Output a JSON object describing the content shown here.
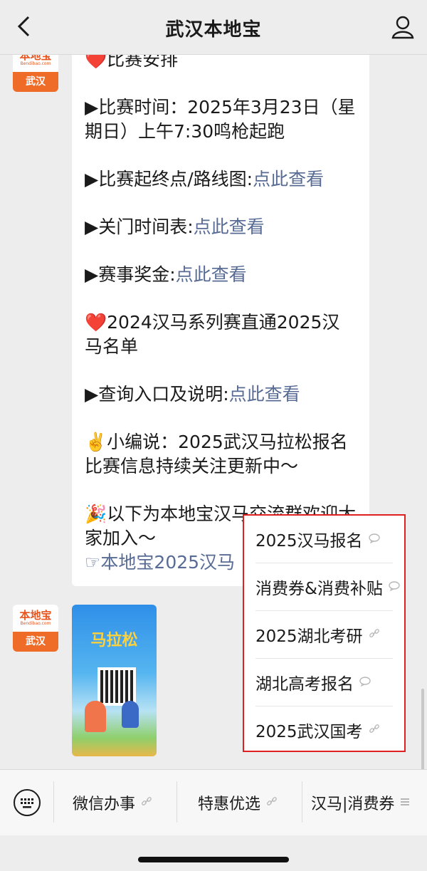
{
  "header": {
    "title": "武汉本地宝"
  },
  "avatar": {
    "brand": "本地宝",
    "domain": "Bendibao.com",
    "city": "武汉"
  },
  "message": {
    "lines": [
      "❤️比赛安排",
      "▶比赛时间：2025年3月23日（星期日）上午7:30鸣枪起跑",
      "▶比赛起终点/路线图:",
      "▶关门时间表:",
      "▶赛事奖金:",
      "❤️2024汉马系列赛直通2025汉马名单",
      "▶查询入口及说明:",
      "✌️小编说：2025武汉马拉松报名比赛信息持续关注更新中～",
      "🎉以下为本地宝汉马交流群欢迎大家加入～",
      "☞本地宝2025汉马"
    ],
    "link_text": "点此查看"
  },
  "poster": {
    "title": "马拉松"
  },
  "popup_menu": {
    "items": [
      {
        "label": "2025汉马报名",
        "icon": "chat-bubble-icon"
      },
      {
        "label": "消费券&消费补贴",
        "icon": "chat-bubble-icon"
      },
      {
        "label": "2025湖北考研",
        "icon": "link-icon"
      },
      {
        "label": "湖北高考报名",
        "icon": "chat-bubble-icon"
      },
      {
        "label": "2025武汉国考",
        "icon": "link-icon"
      }
    ]
  },
  "menubar": {
    "items": [
      {
        "label": "微信办事",
        "icon": "link-icon"
      },
      {
        "label": "特惠优选",
        "icon": "link-icon"
      },
      {
        "label": "汉马|消费券",
        "icon": "menu-lines-icon"
      }
    ]
  }
}
